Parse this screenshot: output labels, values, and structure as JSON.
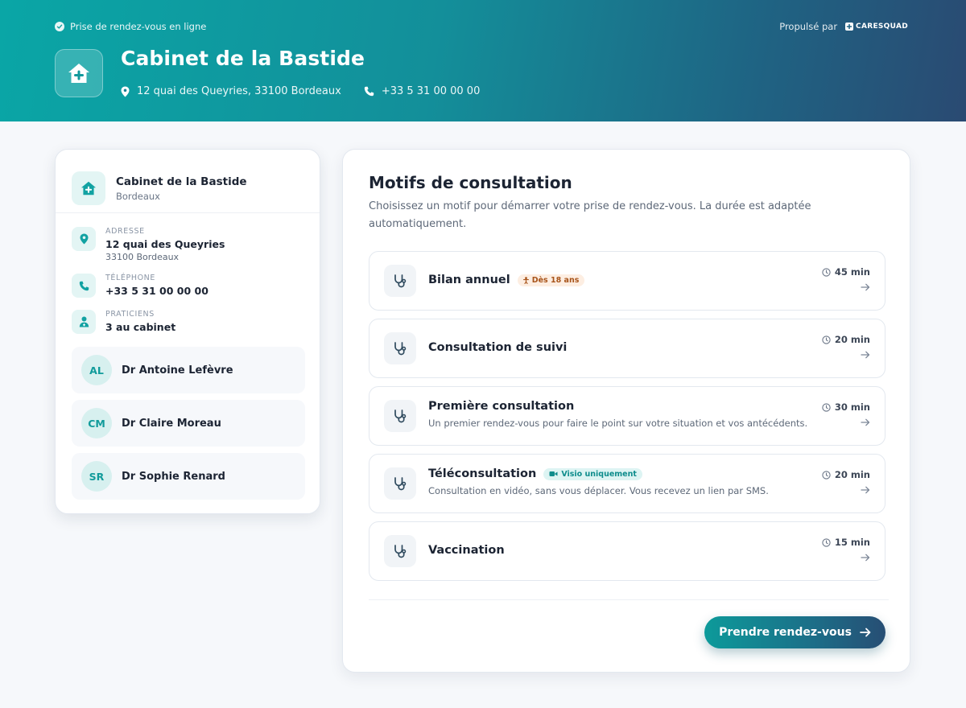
{
  "header": {
    "online_label": "Prise de rendez-vous en ligne",
    "powered_label": "Propulsé par",
    "brand": "CARESQUAD",
    "title": "Cabinet de la Bastide",
    "address": "12 quai des Queyries, 33100 Bordeaux",
    "phone": "+33 5 31 00 00 00"
  },
  "cabinet": {
    "name": "Cabinet de la Bastide",
    "city": "Bordeaux",
    "address_label": "ADRESSE",
    "address_line1": "12 quai des Queyries",
    "address_line2": "33100 Bordeaux",
    "phone_label": "TÉLÉPHONE",
    "phone": "+33 5 31 00 00 00",
    "practitioners_label": "PRATICIENS",
    "practitioners_count": "3 au cabinet",
    "doctors": [
      {
        "initials": "AL",
        "name": "Dr Antoine Lefèvre"
      },
      {
        "initials": "CM",
        "name": "Dr Claire Moreau"
      },
      {
        "initials": "SR",
        "name": "Dr Sophie Renard"
      }
    ]
  },
  "main": {
    "title": "Motifs de consultation",
    "description": "Choisissez un motif pour démarrer votre prise de rendez-vous. La durée est adaptée automatiquement.",
    "motifs": [
      {
        "title": "Bilan annuel",
        "tag": "Dès 18 ans",
        "subtitle": "",
        "duration": "45 min"
      },
      {
        "title": "Consultation de suivi",
        "tag": "",
        "subtitle": "",
        "duration": "20 min"
      },
      {
        "title": "Première consultation",
        "tag": "",
        "subtitle": "Un premier rendez-vous pour faire le point sur votre situation et vos antécédents.",
        "duration": "30 min"
      },
      {
        "title": "Téléconsultation",
        "tag": "Visio uniquement",
        "subtitle": "Consultation en vidéo, sans vous déplacer. Vous recevez un lien par SMS.",
        "duration": "20 min"
      },
      {
        "title": "Vaccination",
        "tag": "",
        "subtitle": "",
        "duration": "15 min"
      }
    ],
    "cta_label": "Prendre rendez-vous"
  },
  "colors": {
    "accent": "#0aa6a6",
    "header_end": "#2a4a72",
    "tag_age_bg": "#fdeee2",
    "tag_visio_bg": "#ddf4f3"
  },
  "icons": {
    "header_logo": "hospital-house-icon",
    "motif": "stethoscope-icon",
    "duration": "clock-icon",
    "row_action": "arrow-right-icon"
  }
}
